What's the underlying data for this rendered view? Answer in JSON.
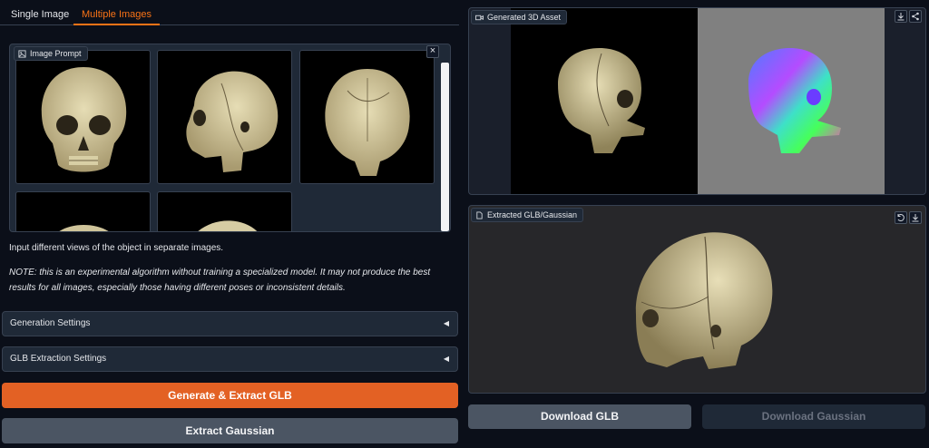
{
  "tabs": [
    {
      "label": "Single Image"
    },
    {
      "label": "Multiple Images"
    }
  ],
  "image_prompt": {
    "label": "Image Prompt",
    "close": "×"
  },
  "instructions": "Input different views of the object in separate images.",
  "note": "NOTE: this is an experimental algorithm without training a specialized model. It may not produce the best results for all images, especially those having different poses or inconsistent details.",
  "accordions": [
    {
      "label": "Generation Settings",
      "arrow": "◀"
    },
    {
      "label": "GLB Extraction Settings",
      "arrow": "◀"
    }
  ],
  "buttons": {
    "generate": "Generate & Extract GLB",
    "extract_gaussian": "Extract Gaussian",
    "download_glb": "Download GLB",
    "download_gaussian": "Download Gaussian"
  },
  "video_panel": {
    "label": "Generated 3D Asset"
  },
  "model_panel": {
    "label": "Extracted GLB/Gaussian"
  },
  "colors": {
    "accent": "#f97316",
    "primary_button": "#e36124",
    "background": "#0b0f19",
    "panel": "#1f2937"
  },
  "icons": [
    "image-icon",
    "close-icon",
    "video-icon",
    "download-icon",
    "share-icon",
    "file-icon",
    "undo-icon"
  ]
}
